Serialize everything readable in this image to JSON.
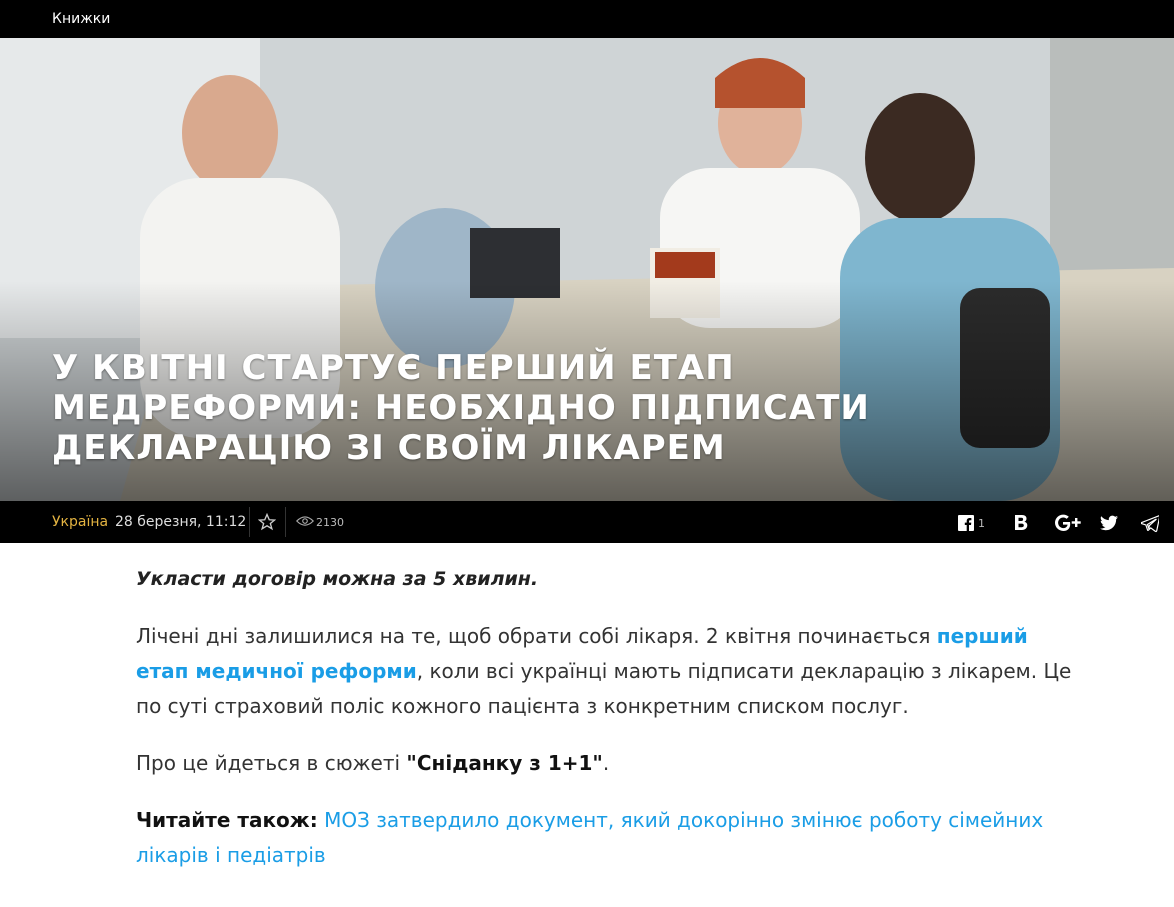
{
  "topnav": {
    "item": "Книжки"
  },
  "hero": {
    "title": "У квітні стартує перший етап медреформи: необхідно підписати декларацію зі своїм лікарем"
  },
  "meta": {
    "region": "Україна",
    "date": "28 березня, 11:12",
    "views": "2130",
    "share_count": "1"
  },
  "icons": {
    "favorite": "star-icon",
    "views": "eye-icon",
    "facebook": "facebook-icon",
    "vk": "vk-icon",
    "gplus": "google-plus-icon",
    "twitter": "twitter-icon",
    "telegram": "telegram-icon"
  },
  "article": {
    "lead": "Укласти договір можна за 5 хвилин.",
    "p1_before": "Лічені дні залишилися на те, щоб обрати собі лікаря. 2 квітня починається ",
    "p1_link": "перший етап медичної реформи",
    "p1_after": ", коли всі українці мають підписати декларацію з лікарем. Це по суті страховий поліс кожного пацієнта з конкретним списком послуг.",
    "p2_before": "Про це йдеться в сюжеті ",
    "p2_strong": "\"Сніданку з 1+1\"",
    "p2_after": ".",
    "p3_label": "Читайте також:",
    "p3_link": "МОЗ затвердило документ, який докорінно змінює роботу сімейних лікарів і педіатрів"
  },
  "colors": {
    "accent_link": "#1a9de6",
    "region": "#e3b341",
    "bar": "#000000"
  }
}
